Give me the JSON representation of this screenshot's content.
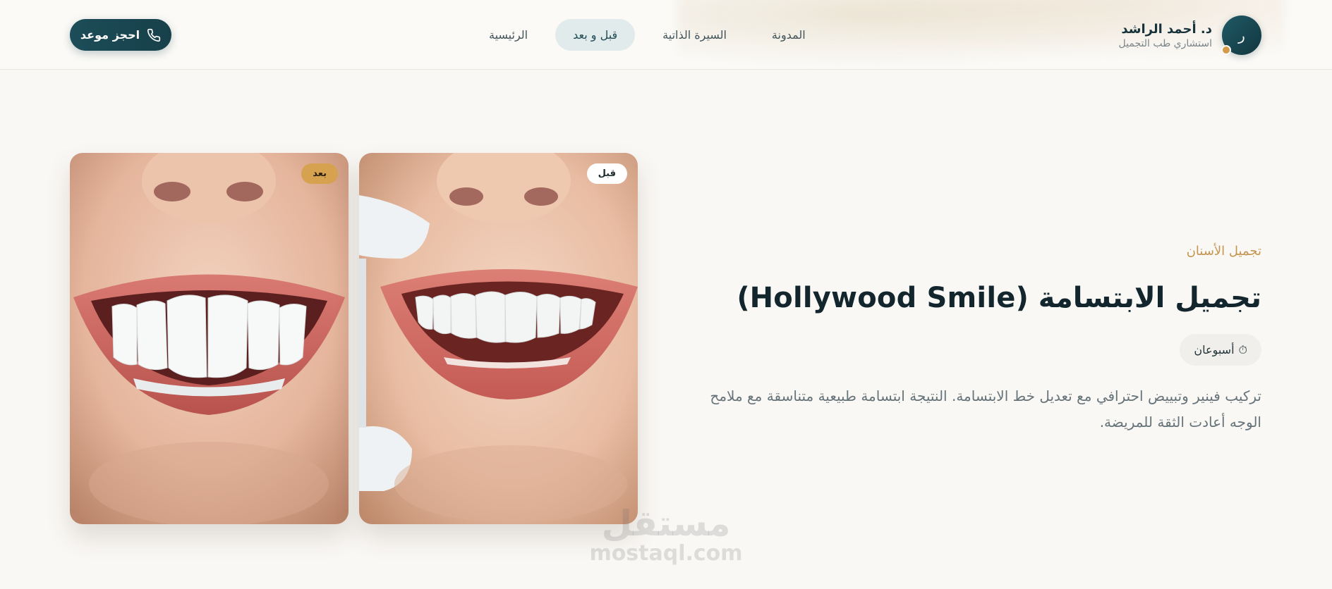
{
  "header": {
    "brand": {
      "avatar_letter": "ر",
      "name": "د. أحمد الراشد",
      "subtitle": "استشاري طب التجميل"
    },
    "nav": [
      {
        "label": "الرئيسية",
        "active": false
      },
      {
        "label": "قبل و بعد",
        "active": true
      },
      {
        "label": "السيرة الذاتية",
        "active": false
      },
      {
        "label": "المدونة",
        "active": false
      }
    ],
    "cta": {
      "label": "احجز موعد",
      "icon": "phone-icon"
    }
  },
  "case": {
    "category": "تجميل الأسنان",
    "title": "تجميل الابتسامة (Hollywood Smile)",
    "duration": {
      "icon": "⏱",
      "label": "أسبوعان"
    },
    "description": "تركيب فينير وتبييض احترافي مع تعديل خط الابتسامة. النتيجة ابتسامة طبيعية متناسقة مع ملامح الوجه أعادت الثقة للمريضة.",
    "images": {
      "after_label": "بعد",
      "before_label": "قبل"
    }
  },
  "watermark": {
    "arabic": "مستقل",
    "latin": "mostaql.com"
  },
  "colors": {
    "primary": "#17404a",
    "accent": "#d7a24f",
    "background": "#faf8f5"
  }
}
